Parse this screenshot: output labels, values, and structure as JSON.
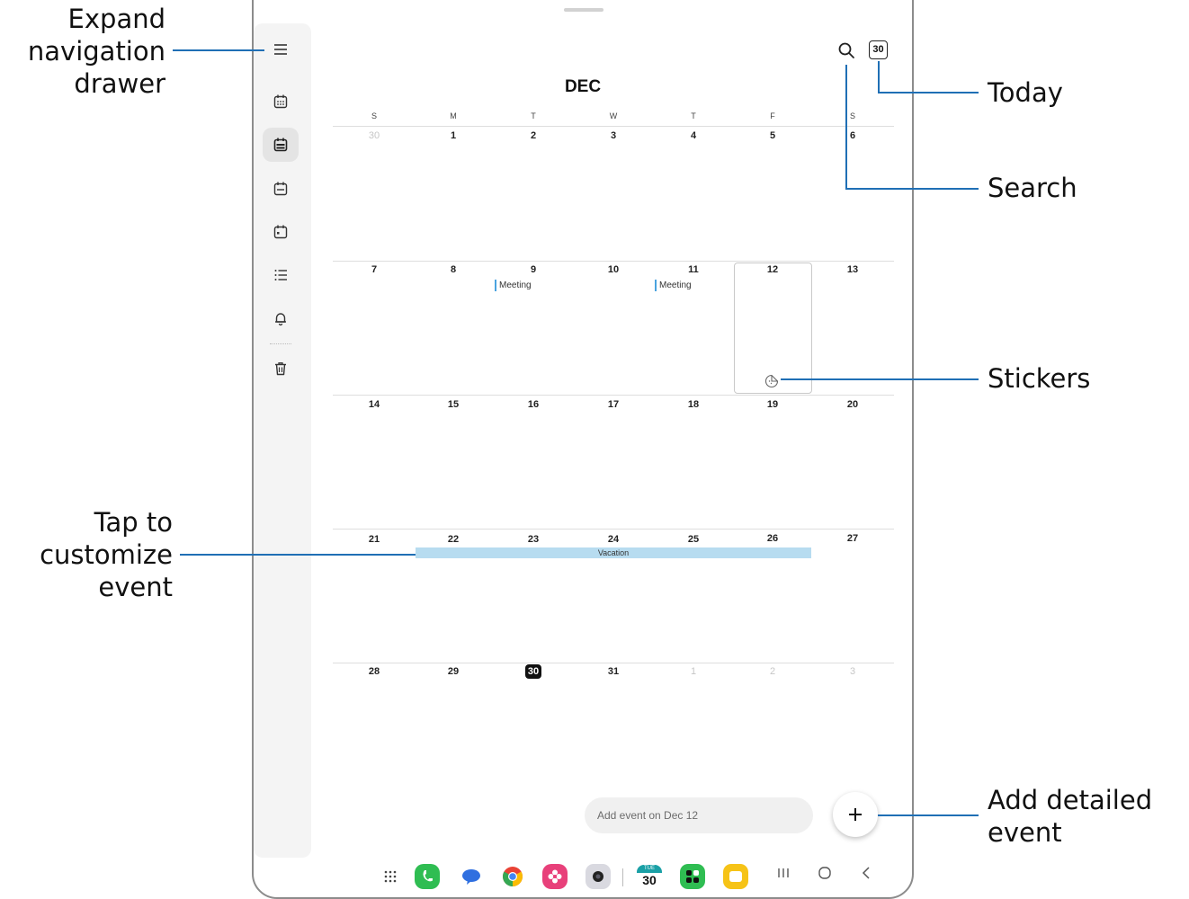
{
  "callouts": {
    "expand_nav": "Expand\nnavigation\ndrawer",
    "today": "Today",
    "search": "Search",
    "stickers": "Stickers",
    "customize_event": "Tap to\ncustomize\nevent",
    "add_detailed_event": "Add detailed\nevent"
  },
  "calendar": {
    "month": "DEC",
    "today_button": "30",
    "weekdays": [
      "S",
      "M",
      "T",
      "W",
      "T",
      "F",
      "S"
    ],
    "weeks": [
      [
        "30",
        "1",
        "2",
        "3",
        "4",
        "5",
        "6"
      ],
      [
        "7",
        "8",
        "9",
        "10",
        "11",
        "12",
        "13"
      ],
      [
        "14",
        "15",
        "16",
        "17",
        "18",
        "19",
        "20"
      ],
      [
        "21",
        "22",
        "23",
        "24",
        "25",
        "26",
        "27"
      ],
      [
        "28",
        "29",
        "30",
        "31",
        "1",
        "2",
        "3"
      ]
    ],
    "events": {
      "dec9": "Meeting",
      "dec11": "Meeting",
      "vacation": "Vacation"
    }
  },
  "add_event_placeholder": "Add event on Dec 12",
  "fab_label": "+",
  "nav_rail_icons": [
    "menu-icon",
    "year-view-icon",
    "month-view-icon",
    "week-view-icon",
    "day-view-icon",
    "list-view-icon",
    "reminder-bell-icon",
    "trash-icon"
  ],
  "dock": {
    "calendar_icon_day": "TUE",
    "calendar_icon_date": "30"
  },
  "colors": {
    "callout_line": "#1f6fb5",
    "event_accent": "#4aa3df",
    "vacation_bar": "#b7dcf0"
  }
}
